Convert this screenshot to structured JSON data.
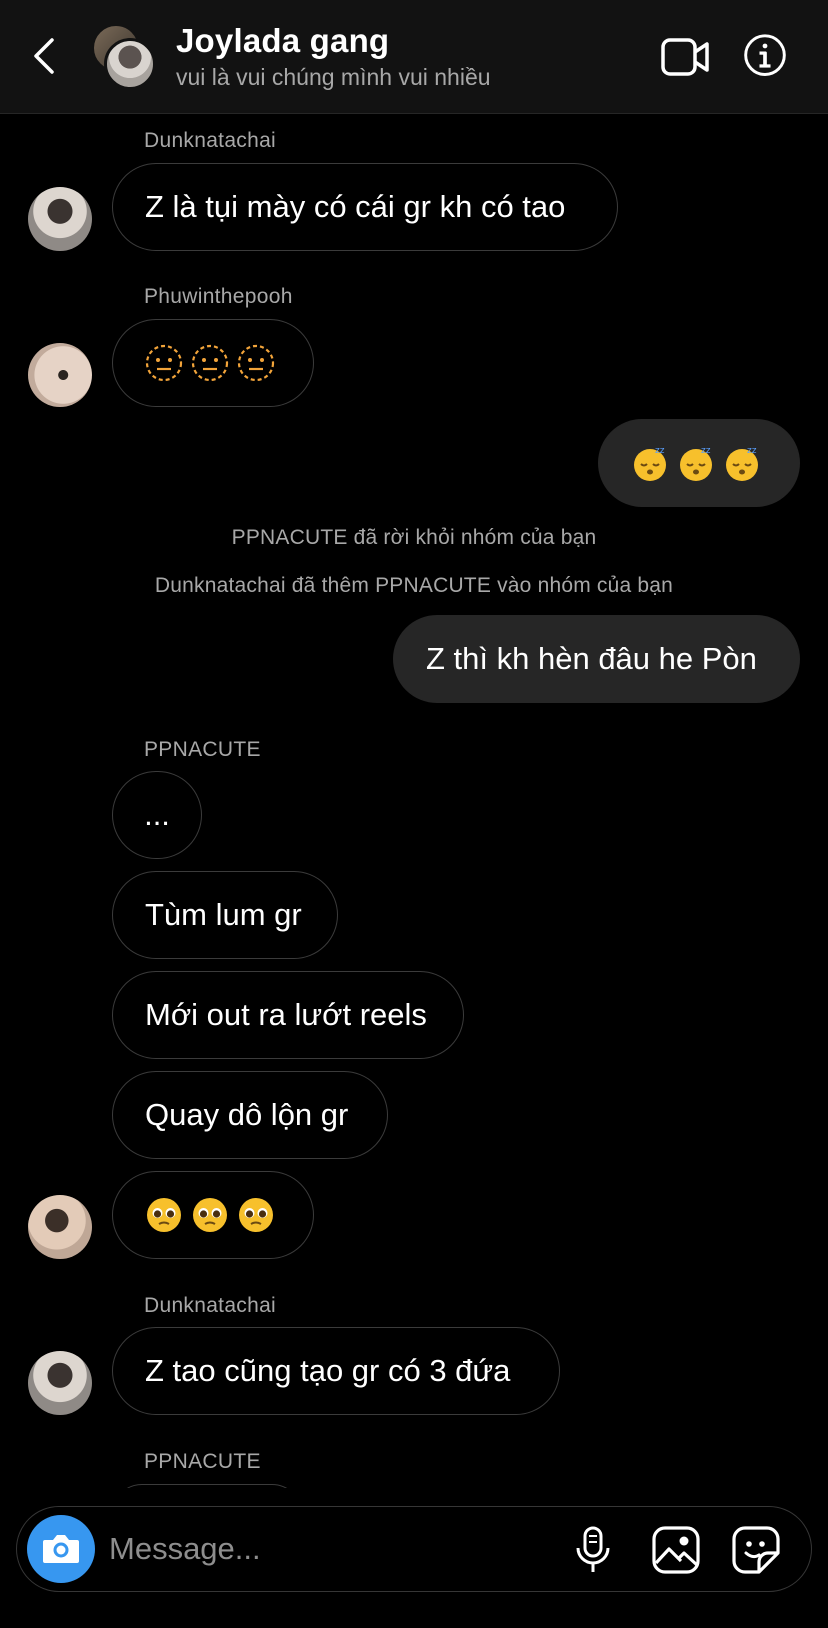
{
  "header": {
    "title": "Joylada gang",
    "subtitle": "vui là vui chúng mình vui nhiều",
    "back_icon": "chevron-left-icon",
    "video_icon": "video-camera-icon",
    "info_icon": "info-icon"
  },
  "messages": {
    "m1": {
      "sender": "Dunknatachai",
      "text": "Z là tụi mày có cái gr kh có tao"
    },
    "m2": {
      "sender": "Phuwinthepooh",
      "emoji": "neutral-dashed-face-emoji",
      "count": 3
    },
    "m3": {
      "emoji": "sleeping-face-emoji",
      "count": 3
    },
    "sys1": "PPNACUTE đã rời khỏi nhóm của bạn",
    "sys2": "Dunknatachai đã thêm PPNACUTE vào nhóm của bạn",
    "m4": {
      "text": "Z thì kh hèn đâu he Pòn"
    },
    "m5": {
      "sender": "PPNACUTE",
      "texts": [
        "...",
        "Tùm lum gr",
        "Mới out ra lướt reels",
        "Quay dô lộn gr"
      ],
      "emoji": "pleading-face-emoji",
      "count": 3
    },
    "m6": {
      "sender": "Dunknatachai",
      "text": "Z tao cũng tạo gr có 3 đứa"
    },
    "m7": {
      "sender": "PPNACUTE"
    }
  },
  "composer": {
    "placeholder": "Message...",
    "icons": [
      "camera-icon",
      "microphone-icon",
      "gallery-icon",
      "sticker-icon"
    ]
  },
  "colors": {
    "background": "#000000",
    "header_bg": "#121212",
    "outgoing_bubble": "#262626",
    "bubble_border": "#3b3b3b",
    "secondary_text": "#a8a8a8",
    "camera_button": "#3797f0"
  }
}
